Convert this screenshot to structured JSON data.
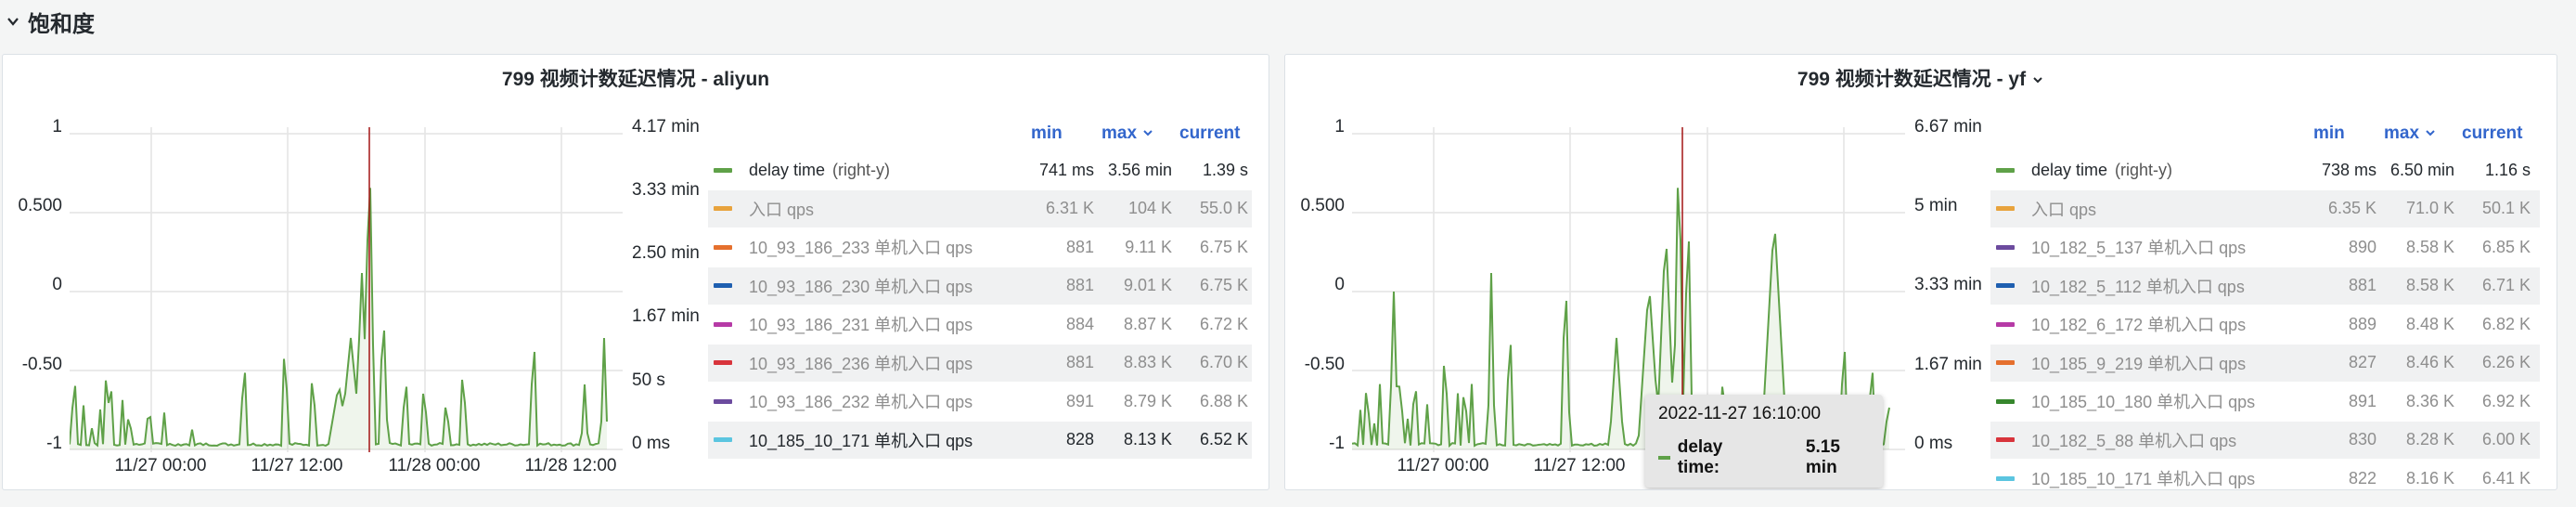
{
  "row": {
    "title": "饱和度"
  },
  "colors": {
    "delay": "#5fa148",
    "grid": "#e4e4e4",
    "marker": "#a31515",
    "link": "#3366cc"
  },
  "panels": [
    {
      "title": "799 视频计数延迟情况 - aliyun",
      "y_left": [
        "1",
        "0.500",
        "0",
        "-0.50",
        "-1"
      ],
      "y_right": [
        "4.17 min",
        "3.33 min",
        "2.50 min",
        "1.67 min",
        "50 s",
        "0 ms"
      ],
      "x_ticks": [
        "11/27 00:00",
        "11/27 12:00",
        "11/28 00:00",
        "11/28 12:00"
      ],
      "legend_headers": {
        "min": "min",
        "max": "max",
        "current": "current"
      },
      "series": [
        {
          "name": "delay time",
          "suffix": "(right-y)",
          "color": "#5fa148",
          "min": "741 ms",
          "max": "3.56 min",
          "current": "1.39 s",
          "dim": false
        },
        {
          "name": "入口 qps",
          "color": "#e8a33d",
          "min": "6.31 K",
          "max": "104 K",
          "current": "55.0 K",
          "dim": true
        },
        {
          "name": "10_93_186_233 单机入口 qps",
          "color": "#e5702e",
          "min": "881",
          "max": "9.11 K",
          "current": "6.75 K",
          "dim": true
        },
        {
          "name": "10_93_186_230 单机入口 qps",
          "color": "#1f5fb0",
          "min": "881",
          "max": "9.01 K",
          "current": "6.75 K",
          "dim": true
        },
        {
          "name": "10_93_186_231 单机入口 qps",
          "color": "#b63aa6",
          "min": "884",
          "max": "8.87 K",
          "current": "6.72 K",
          "dim": true
        },
        {
          "name": "10_93_186_236 单机入口 qps",
          "color": "#d8343c",
          "min": "881",
          "max": "8.83 K",
          "current": "6.70 K",
          "dim": true
        },
        {
          "name": "10_93_186_232 单机入口 qps",
          "color": "#6c4b9e",
          "min": "891",
          "max": "8.79 K",
          "current": "6.88 K",
          "dim": true
        },
        {
          "name": "10_185_10_171 单机入口 qps",
          "color": "#5bc5e0",
          "min": "828",
          "max": "8.13 K",
          "current": "6.52 K",
          "dim": false
        }
      ]
    },
    {
      "title": "799 视频计数延迟情况 - yf",
      "y_left": [
        "1",
        "0.500",
        "0",
        "-0.50",
        "-1"
      ],
      "y_right": [
        "6.67 min",
        "5 min",
        "3.33 min",
        "1.67 min",
        "0 ms"
      ],
      "x_ticks": [
        "11/27 00:00",
        "11/27 12:00"
      ],
      "legend_headers": {
        "min": "min",
        "max": "max",
        "current": "current"
      },
      "series": [
        {
          "name": "delay time",
          "suffix": "(right-y)",
          "color": "#5fa148",
          "min": "738 ms",
          "max": "6.50 min",
          "current": "1.16 s",
          "dim": false
        },
        {
          "name": "入口 qps",
          "color": "#e8a33d",
          "min": "6.35 K",
          "max": "71.0 K",
          "current": "50.1 K",
          "dim": true
        },
        {
          "name": "10_182_5_137 单机入口 qps",
          "color": "#6c4b9e",
          "min": "890",
          "max": "8.58 K",
          "current": "6.85 K",
          "dim": true
        },
        {
          "name": "10_182_5_112 单机入口 qps",
          "color": "#1f5fb0",
          "min": "881",
          "max": "8.58 K",
          "current": "6.71 K",
          "dim": true
        },
        {
          "name": "10_182_6_172 单机入口 qps",
          "color": "#b63aa6",
          "min": "889",
          "max": "8.48 K",
          "current": "6.82 K",
          "dim": true
        },
        {
          "name": "10_185_9_219 单机入口 qps",
          "color": "#e5702e",
          "min": "827",
          "max": "8.46 K",
          "current": "6.26 K",
          "dim": true
        },
        {
          "name": "10_185_10_180 单机入口 qps",
          "color": "#37872d",
          "min": "891",
          "max": "8.36 K",
          "current": "6.92 K",
          "dim": true
        },
        {
          "name": "10_182_5_88 单机入口 qps",
          "color": "#d8343c",
          "min": "830",
          "max": "8.28 K",
          "current": "6.00 K",
          "dim": true
        },
        {
          "name": "10_185_10_171 单机入口 qps",
          "color": "#5bc5e0",
          "min": "822",
          "max": "8.16 K",
          "current": "6.41 K",
          "dim": true
        }
      ],
      "tooltip": {
        "time": "2022-11-27 16:10:00",
        "label": "delay time:",
        "value": "5.15 min"
      }
    }
  ]
}
